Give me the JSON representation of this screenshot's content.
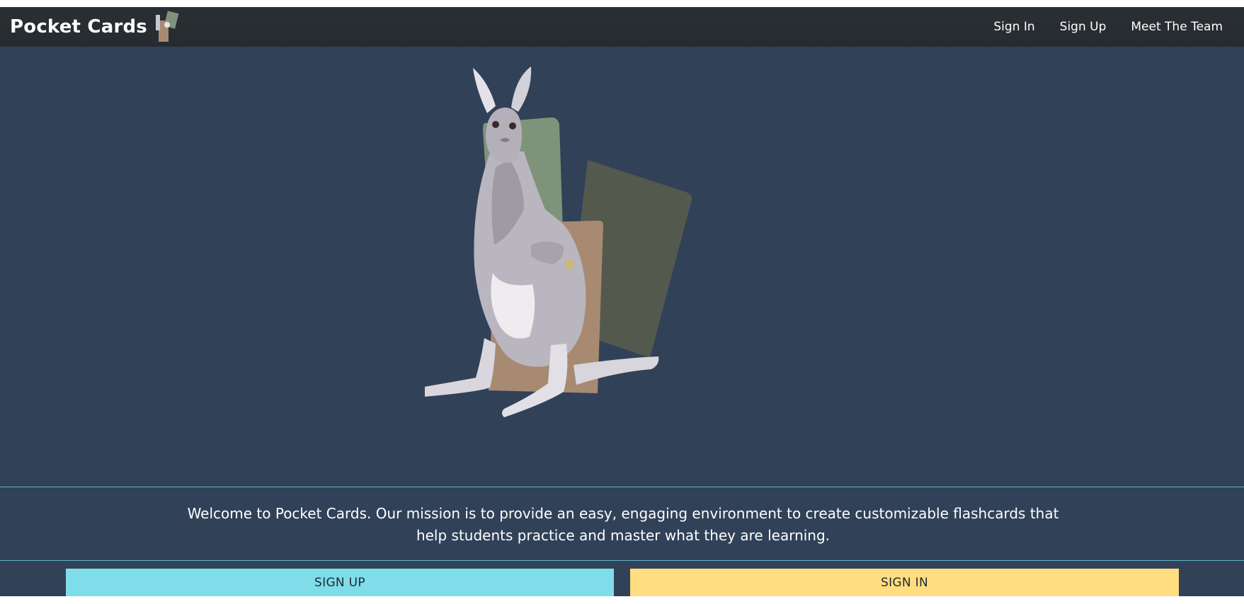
{
  "navbar": {
    "brand_text": "Pocket Cards",
    "logo_icon": "kangaroo-cards-logo-icon",
    "links": [
      {
        "label": "Sign In"
      },
      {
        "label": "Sign Up"
      },
      {
        "label": "Meet The Team"
      }
    ]
  },
  "hero": {
    "illustration": "kangaroo-with-flashcards-illustration"
  },
  "mission": {
    "text": "Welcome to Pocket Cards. Our mission is to provide an easy, engaging environment to create customizable flashcards that help students practice and master what they are learning."
  },
  "actions": {
    "signup_label": "SIGN UP",
    "signin_label": "SIGN IN"
  },
  "colors": {
    "navbar_bg": "#282e33",
    "hero_bg": "#314158",
    "divider": "#5fb6c4",
    "signup_button": "#7fdde9",
    "signin_button": "#ffdd80",
    "card_green": "#7f937a",
    "card_darkgreen": "#53594d",
    "card_tan": "#a88a73"
  }
}
